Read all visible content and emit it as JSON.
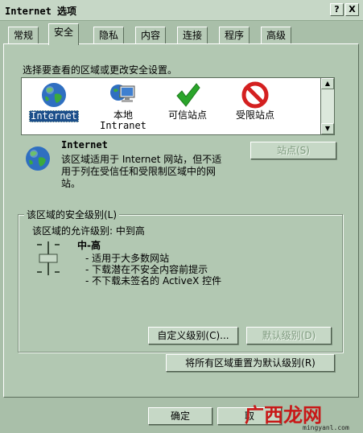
{
  "window": {
    "title": "Internet 选项",
    "help_label": "?",
    "close_label": "X"
  },
  "tabs": [
    {
      "label": "常规"
    },
    {
      "label": "安全"
    },
    {
      "label": "隐私"
    },
    {
      "label": "内容"
    },
    {
      "label": "连接"
    },
    {
      "label": "程序"
    },
    {
      "label": "高级"
    }
  ],
  "active_tab": "安全",
  "security": {
    "select_prompt": "选择要查看的区域或更改安全设置。",
    "zones": [
      {
        "name": "Internet",
        "icon": "globe-icon",
        "selected": true
      },
      {
        "name": "本地\nIntranet",
        "icon": "intranet-icon",
        "selected": false
      },
      {
        "name": "可信站点",
        "icon": "checkmark-icon",
        "selected": false
      },
      {
        "name": "受限站点",
        "icon": "restricted-icon",
        "selected": false
      }
    ],
    "zone_title": "Internet",
    "zone_description": "该区域适用于 Internet 网站，但不适用于列在受信任和受限制区域中的网站。",
    "sites_button": "站点(S)",
    "group_label": "该区域的安全级别(L)",
    "allowed_levels": "该区域的允许级别: 中到高",
    "level_name": "中-高",
    "level_bullets": [
      "- 适用于大多数网站",
      "- 下载潜在不安全内容前提示",
      "- 不下载未签名的 ActiveX 控件"
    ],
    "custom_level_button": "自定义级别(C)...",
    "default_level_button": "默认级别(D)",
    "reset_all_button": "将所有区域重置为默认级别(R)"
  },
  "footer": {
    "ok_button": "确定",
    "cancel_button": "取"
  },
  "watermark": {
    "text": "广西龙网",
    "url": "mingyanl.com"
  },
  "colors": {
    "window_bg": "#a9bfa9",
    "panel_bg": "#b2c8b2",
    "selection": "#1b4e8a",
    "restricted": "#d42020",
    "trusted": "#2aa52a",
    "watermark": "#c81818"
  }
}
